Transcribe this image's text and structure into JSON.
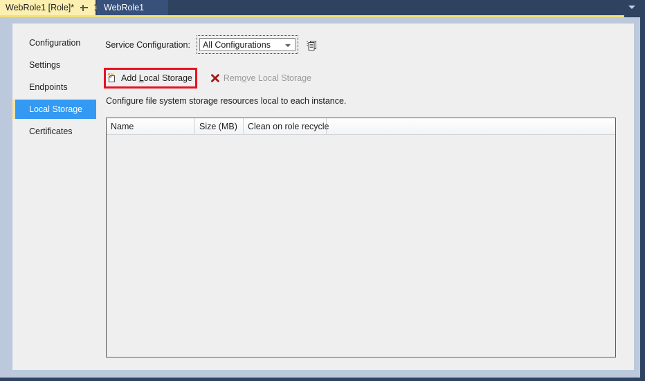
{
  "window": {
    "tabs": [
      {
        "label": "WebRole1 [Role]*",
        "active": true,
        "pin_icon": "pin-icon",
        "close_icon": "close-icon"
      },
      {
        "label": "WebRole1",
        "active": false
      }
    ],
    "overflow_icon": "chevron-down-icon"
  },
  "sidebar": {
    "items": [
      {
        "label": "Configuration",
        "selected": false
      },
      {
        "label": "Settings",
        "selected": false
      },
      {
        "label": "Endpoints",
        "selected": false
      },
      {
        "label": "Local Storage",
        "selected": true
      },
      {
        "label": "Certificates",
        "selected": false
      }
    ]
  },
  "service_configuration": {
    "label": "Service Configuration:",
    "selected_value": "All Configurations",
    "options": [
      "All Configurations"
    ],
    "chevron_icon": "chevron-down-icon",
    "copy_icon": "copy-pages-icon"
  },
  "toolbar": {
    "add_label_pre": "Add ",
    "add_label_accel": "L",
    "add_label_post": "ocal Storage",
    "add_label_full": "Add Local Storage",
    "add_icon": "add-storage-icon",
    "add_highlight_color": "#e81123",
    "remove_label_pre": "Rem",
    "remove_label_accel": "o",
    "remove_label_post": "ve Local Storage",
    "remove_label_full": "Remove Local Storage",
    "remove_icon": "red-x-icon",
    "remove_enabled": false
  },
  "description": "Configure file system storage resources local to each instance.",
  "grid": {
    "columns": [
      "Name",
      "Size (MB)",
      "Clean on role recycle"
    ],
    "rows": []
  },
  "colors": {
    "accent_blue": "#3399f3",
    "chrome_navy": "#2f4260",
    "active_tab_yellow": "#fcefb0",
    "inactive_tab_blue": "#37517a",
    "inset_band": "#bcc9dd",
    "panel_gray": "#efefef",
    "highlight_red": "#e81123"
  }
}
